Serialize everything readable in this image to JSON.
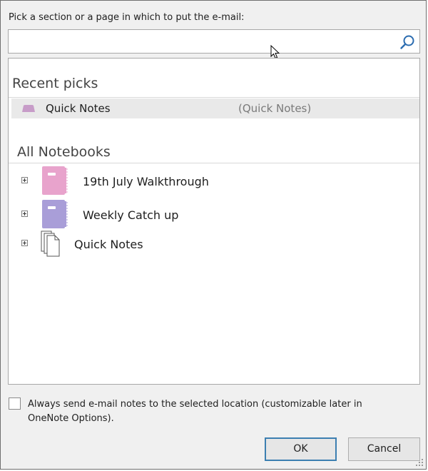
{
  "dialog": {
    "prompt": "Pick a section or a page in which to put the e-mail:",
    "search": {
      "value": "",
      "placeholder": ""
    }
  },
  "recent": {
    "title": "Recent picks",
    "items": [
      {
        "name": "Quick Notes",
        "location": "(Quick Notes)",
        "icon": "section-tab-icon",
        "color": "#c79cc8"
      }
    ]
  },
  "all_notebooks": {
    "title": "All Notebooks",
    "items": [
      {
        "name": "19th July Walkthrough",
        "icon": "notebook-icon",
        "color": "#e8a3cc"
      },
      {
        "name": "Weekly Catch up",
        "icon": "notebook-icon",
        "color": "#a99ed8"
      },
      {
        "name": "Quick Notes",
        "icon": "quick-notes-pages-icon",
        "color": "#ffffff"
      }
    ]
  },
  "options": {
    "always_send_label": "Always send e-mail notes to the selected location (customizable later in OneNote Options).",
    "always_send_checked": false
  },
  "buttons": {
    "ok": "OK",
    "cancel": "Cancel"
  }
}
